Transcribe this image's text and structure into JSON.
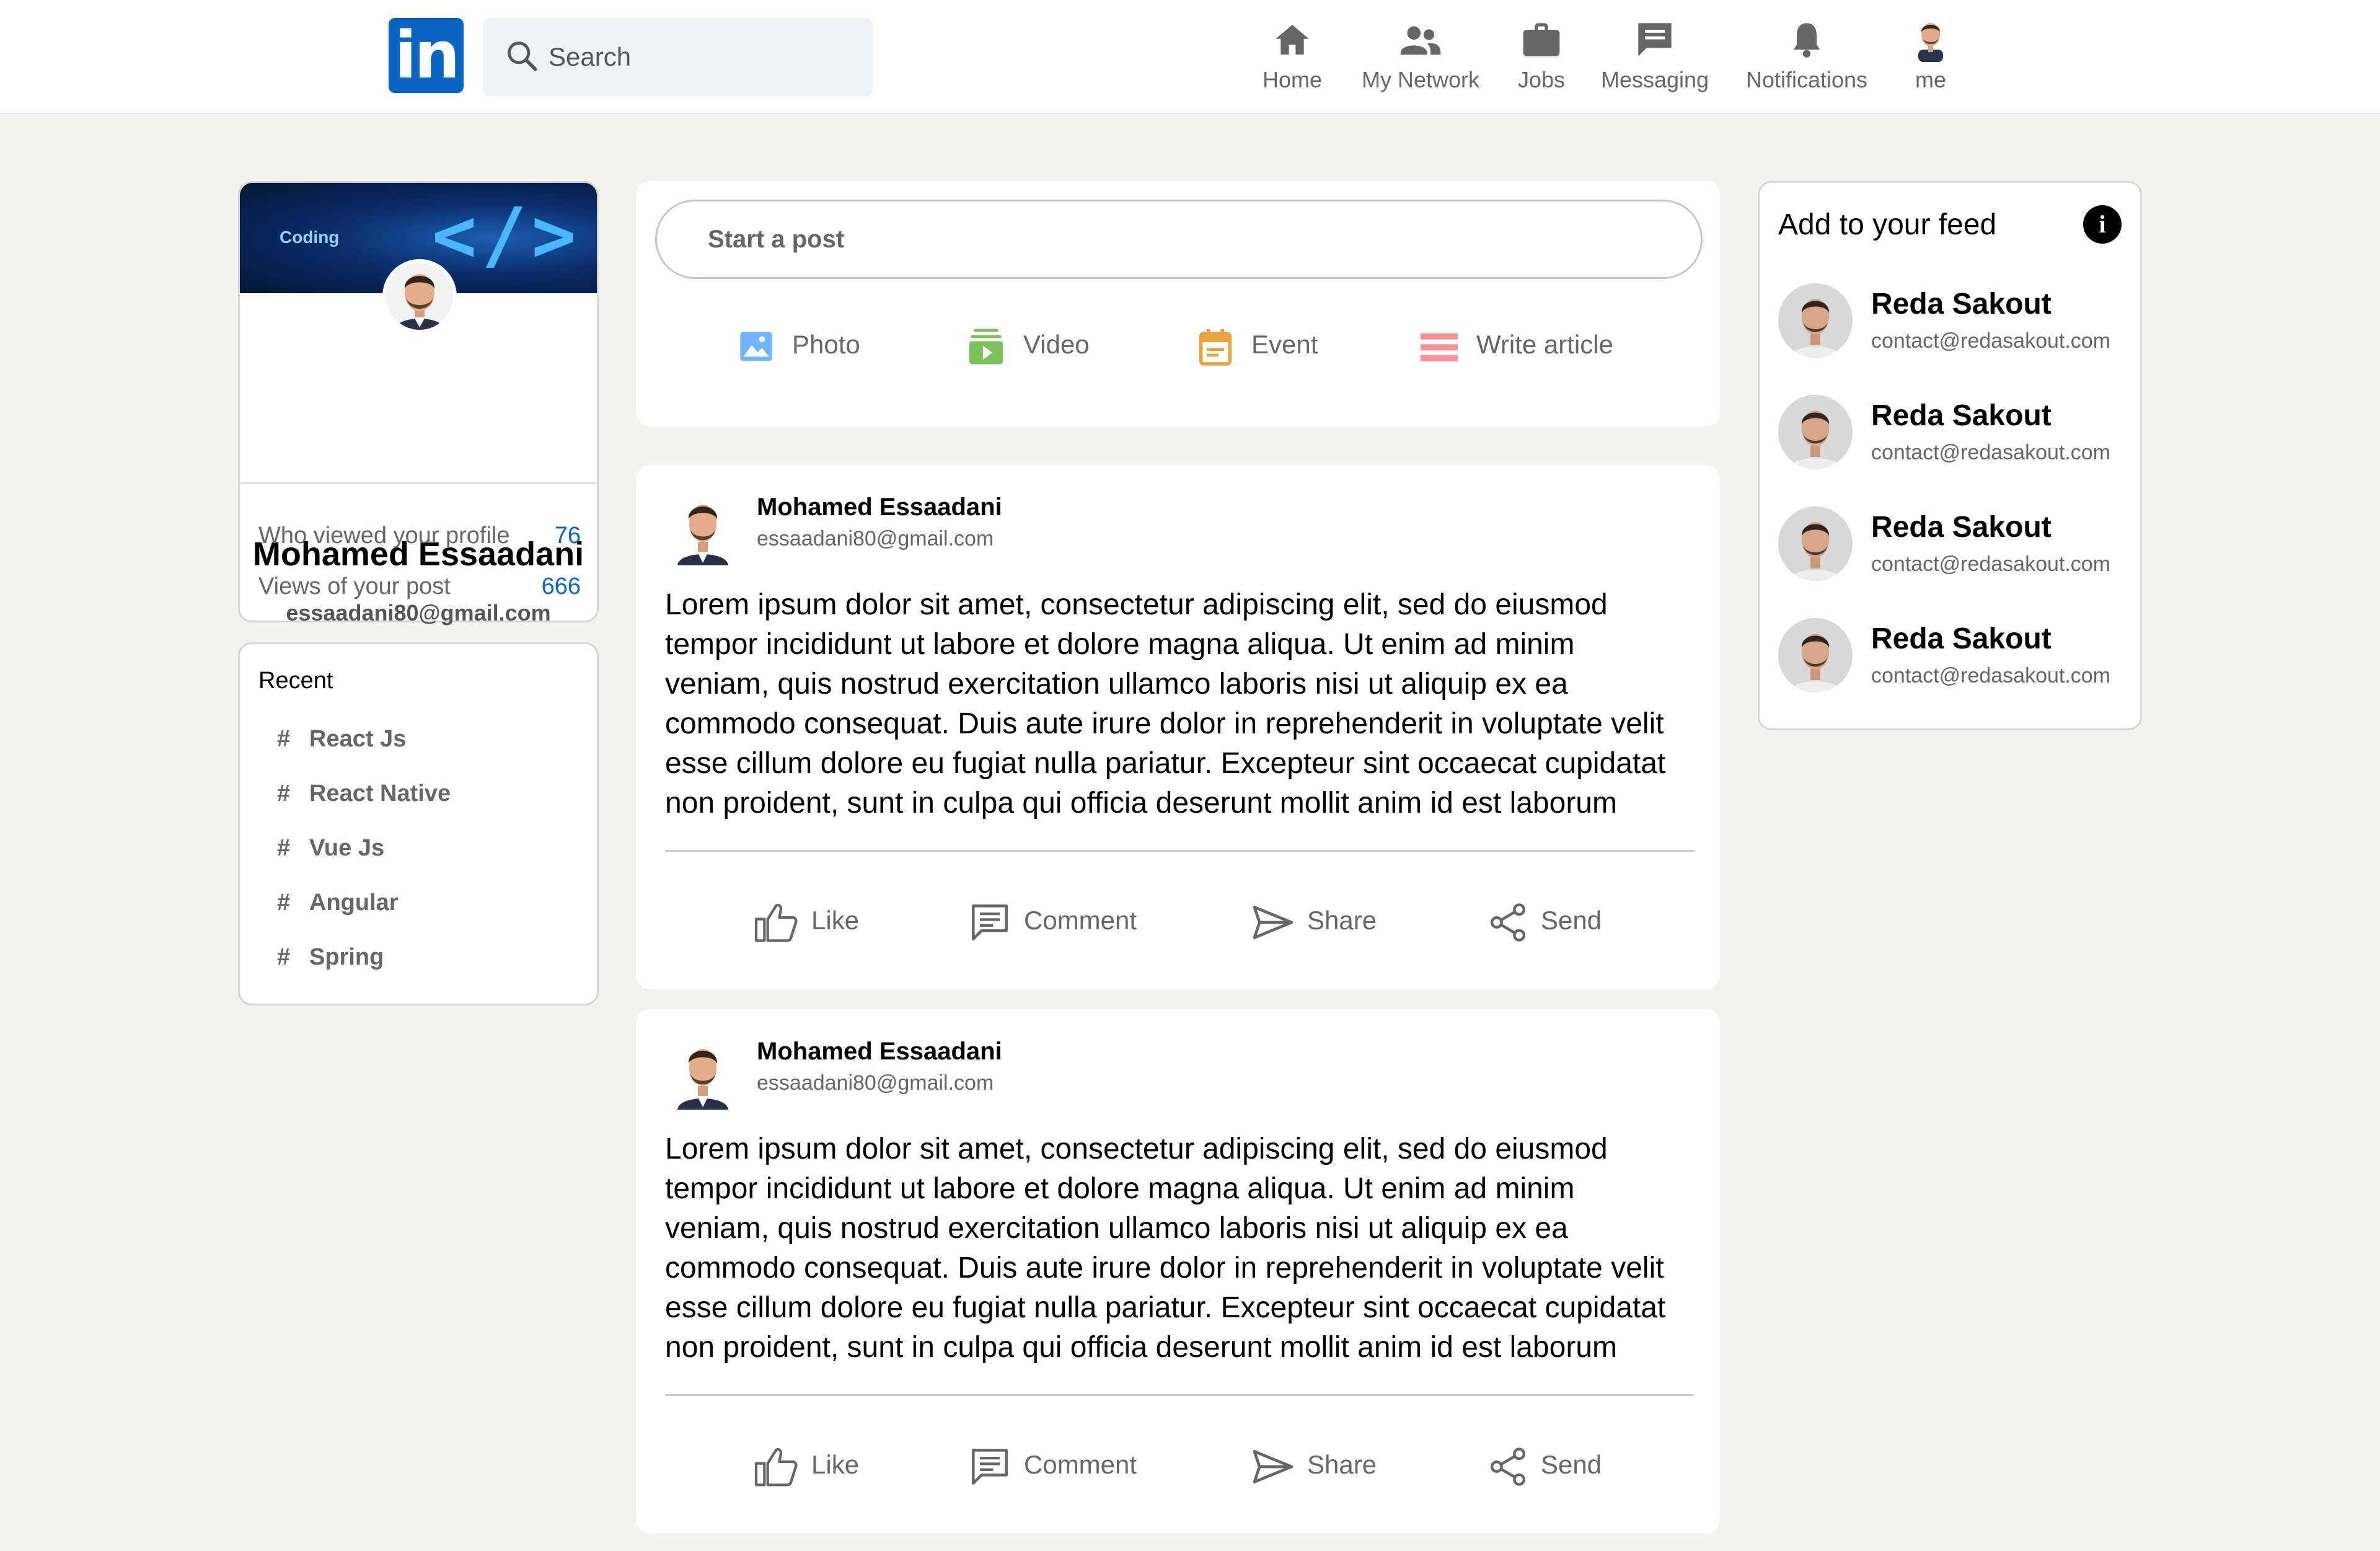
{
  "header": {
    "logo_text": "in",
    "search": {
      "placeholder": "Search",
      "value": ""
    },
    "nav": [
      {
        "label": "Home",
        "icon": "home-icon"
      },
      {
        "label": "My Network",
        "icon": "people-icon"
      },
      {
        "label": "Jobs",
        "icon": "briefcase-icon"
      },
      {
        "label": "Messaging",
        "icon": "message-icon"
      },
      {
        "label": "Notifications",
        "icon": "bell-icon"
      },
      {
        "label": "me",
        "icon": "avatar"
      }
    ]
  },
  "profile": {
    "banner_text": "Coding",
    "banner_code": "</>",
    "name": "Mohamed Essaadani",
    "email": "essaadani80@gmail.com",
    "stats": [
      {
        "label": "Who viewed your profile",
        "value": "76"
      },
      {
        "label": "Views of your post",
        "value": "666"
      }
    ]
  },
  "recent": {
    "title": "Recent",
    "hash": "#",
    "tags": [
      "React Js",
      "React Native",
      "Vue Js",
      "Angular",
      "Spring"
    ]
  },
  "compose": {
    "placeholder": "Start a post",
    "actions": [
      {
        "label": "Photo",
        "icon": "photo-icon",
        "color": "#70b5f9"
      },
      {
        "label": "Video",
        "icon": "video-icon",
        "color": "#7fc15e"
      },
      {
        "label": "Event",
        "icon": "calendar-icon",
        "color": "#e7a33e"
      },
      {
        "label": "Write article",
        "icon": "article-icon",
        "color": "#fc9295"
      }
    ]
  },
  "posts": [
    {
      "author": "Mohamed Essaadani",
      "email": "essaadani80@gmail.com",
      "lines": [
        "Lorem ipsum dolor sit amet, consectetur adipiscing elit, sed do eiusmod",
        "tempor incididunt ut labore et dolore magna aliqua. Ut enim ad minim",
        "veniam, quis nostrud exercitation ullamco laboris nisi ut aliquip ex ea",
        "commodo consequat. Duis aute irure dolor in reprehenderit in voluptate velit",
        "esse cillum dolore eu fugiat nulla pariatur. Excepteur sint occaecat cupidatat",
        "non proident, sunt in culpa qui officia deserunt mollit anim id est laborum"
      ],
      "actions": [
        "Like",
        "Comment",
        "Share",
        "Send"
      ]
    },
    {
      "author": "Mohamed Essaadani",
      "email": "essaadani80@gmail.com",
      "lines": [
        "Lorem ipsum dolor sit amet, consectetur adipiscing elit, sed do eiusmod",
        "tempor incididunt ut labore et dolore magna aliqua. Ut enim ad minim",
        "veniam, quis nostrud exercitation ullamco laboris nisi ut aliquip ex ea",
        "commodo consequat. Duis aute irure dolor in reprehenderit in voluptate velit",
        "esse cillum dolore eu fugiat nulla pariatur. Excepteur sint occaecat cupidatat",
        "non proident, sunt in culpa qui officia deserunt mollit anim id est laborum"
      ],
      "actions": [
        "Like",
        "Comment",
        "Share",
        "Send"
      ]
    }
  ],
  "feed": {
    "title": "Add to your feed",
    "info_glyph": "i",
    "items": [
      {
        "name": "Reda Sakout",
        "email": "contact@redasakout.com"
      },
      {
        "name": "Reda Sakout",
        "email": "contact@redasakout.com"
      },
      {
        "name": "Reda Sakout",
        "email": "contact@redasakout.com"
      },
      {
        "name": "Reda Sakout",
        "email": "contact@redasakout.com"
      }
    ]
  },
  "colors": {
    "brand": "#0a66c2",
    "page_bg": "#f3f2ef",
    "muted_text": "#666666"
  }
}
